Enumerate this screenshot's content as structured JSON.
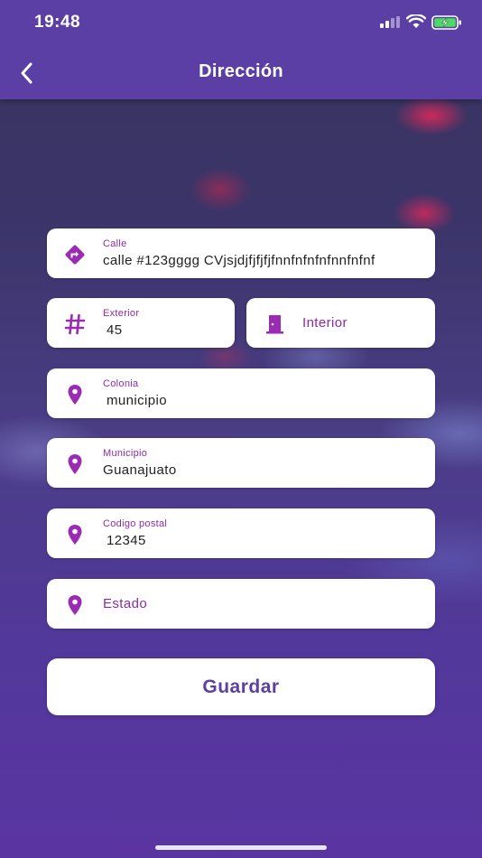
{
  "status_bar": {
    "time": "19:48"
  },
  "nav": {
    "title": "Dirección",
    "back_icon": "chevron-left-icon"
  },
  "form": {
    "calle": {
      "label": "Calle",
      "value": "calle #123gggg CVjsjdjfjfjfjfnnfnfnfnfnnfnfnf",
      "icon": "directions-icon"
    },
    "exterior": {
      "label": "Exterior",
      "value": "45",
      "icon": "hash-icon"
    },
    "interior": {
      "placeholder": "Interior",
      "icon": "door-icon"
    },
    "colonia": {
      "label": "Colonia",
      "value": "municipio",
      "icon": "location-pin-icon"
    },
    "municipio": {
      "label": "Municipio",
      "value": "Guanajuato",
      "icon": "location-pin-icon"
    },
    "codigo_postal": {
      "label": "Codigo postal",
      "value": "12345",
      "icon": "location-pin-icon"
    },
    "estado": {
      "placeholder": "Estado",
      "icon": "location-pin-icon"
    }
  },
  "actions": {
    "save_label": "Guardar"
  },
  "colors": {
    "accent": "#5b3fa5",
    "label": "#8e2aa8",
    "icon": "#9b2bb5"
  }
}
